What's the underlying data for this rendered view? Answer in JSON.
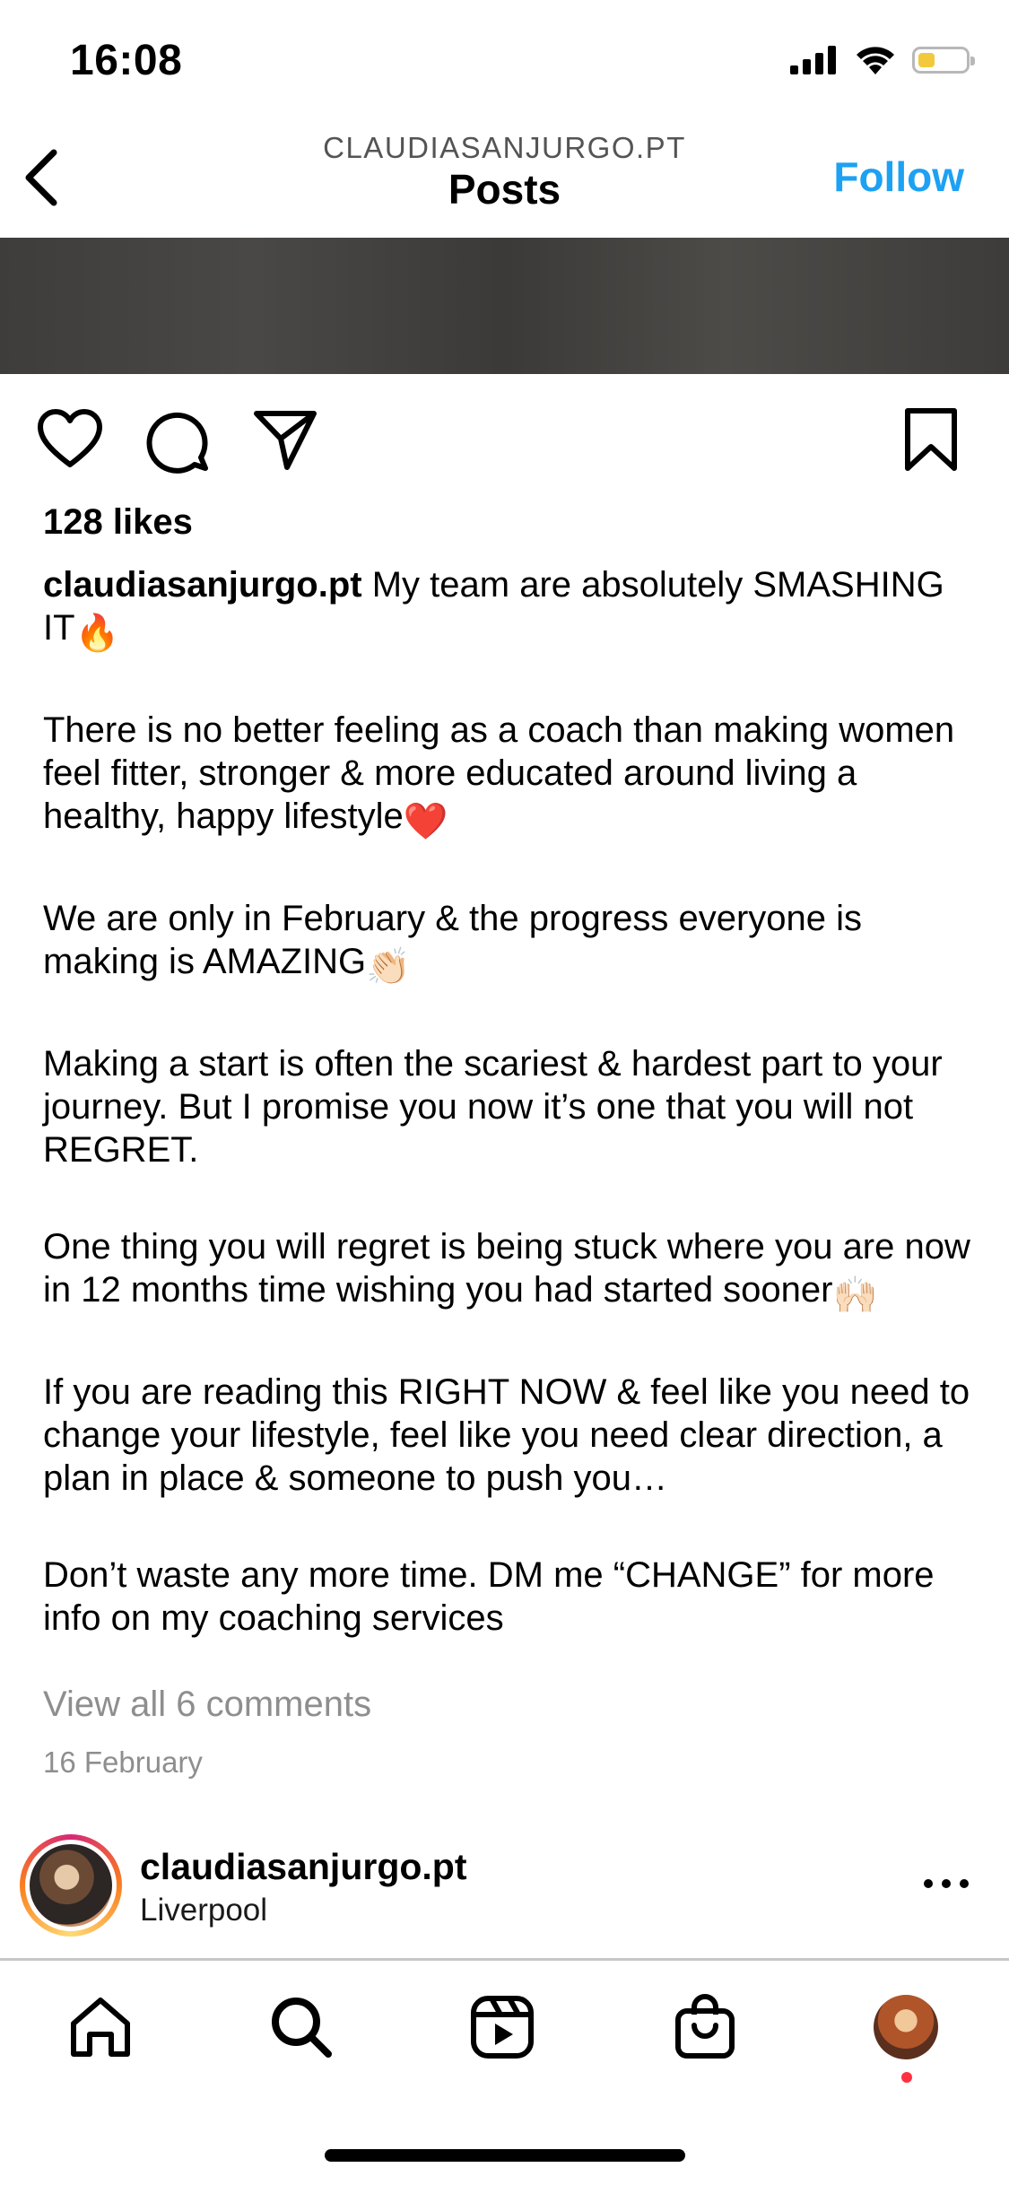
{
  "status_bar": {
    "time": "16:08",
    "battery_level": 0.35,
    "battery_color": "#f1c93a"
  },
  "header": {
    "account": "CLAUDIASANJURGO.PT",
    "title": "Posts",
    "follow_label": "Follow"
  },
  "post": {
    "likes": "128 likes",
    "username": "claudiasanjurgo.pt",
    "caption": {
      "p1": "My team are absolutely SMASHING IT",
      "p2": "There is no better feeling as a coach than making women feel fitter, stronger & more educated around living a healthy, happy lifestyle",
      "p3": "We are only in February & the progress everyone is making is AMAZING",
      "p4": "Making a start is often the scariest & hardest part to your journey. But I promise you now it’s one that you will not REGRET.",
      "p5": "One thing you will regret is being stuck where you are now in 12 months time wishing you had started sooner",
      "p6": "If you are reading this RIGHT NOW & feel like you need to change your lifestyle, feel like you need clear direction, a plan in place & someone to push you…",
      "p7": "Don’t waste any more time. DM me “CHANGE” for more info on my coaching services"
    },
    "emojis": {
      "fire": "🔥",
      "heart": "❤️",
      "clap": "👏🏻",
      "raised_hands": "🙌🏻"
    },
    "view_comments": "View all 6 comments",
    "date": "16 February"
  },
  "next_post": {
    "username": "claudiasanjurgo.pt",
    "location": "Liverpool"
  },
  "colors": {
    "accent": "#1da1f2",
    "muted_text": "#8e8e8e"
  }
}
